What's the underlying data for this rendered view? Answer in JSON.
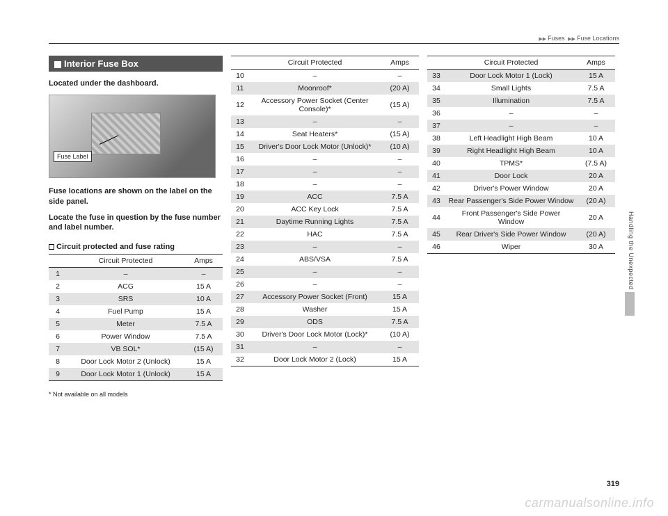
{
  "breadcrumb": {
    "part1": "Fuses",
    "part2": "Fuse Locations"
  },
  "section_title": "Interior Fuse Box",
  "intro_line": "Located under the dashboard.",
  "figure_label": "Fuse Label",
  "para1": "Fuse locations are shown on the label on the side panel.",
  "para2": "Locate the fuse in question by the fuse number and label number.",
  "subhead": "Circuit protected and fuse rating",
  "headers": {
    "circuit": "Circuit Protected",
    "amps": "Amps"
  },
  "table1": [
    {
      "n": "1",
      "c": "–",
      "a": "–"
    },
    {
      "n": "2",
      "c": "ACG",
      "a": "15 A"
    },
    {
      "n": "3",
      "c": "SRS",
      "a": "10 A"
    },
    {
      "n": "4",
      "c": "Fuel Pump",
      "a": "15 A"
    },
    {
      "n": "5",
      "c": "Meter",
      "a": "7.5 A"
    },
    {
      "n": "6",
      "c": "Power Window",
      "a": "7.5 A"
    },
    {
      "n": "7",
      "c": "VB SOL*",
      "a": "(15 A)"
    },
    {
      "n": "8",
      "c": "Door Lock Motor 2 (Unlock)",
      "a": "15 A"
    },
    {
      "n": "9",
      "c": "Door Lock Motor 1 (Unlock)",
      "a": "15 A"
    }
  ],
  "table2": [
    {
      "n": "10",
      "c": "–",
      "a": "–"
    },
    {
      "n": "11",
      "c": "Moonroof*",
      "a": "(20 A)"
    },
    {
      "n": "12",
      "c": "Accessory Power Socket (Center Console)*",
      "a": "(15 A)"
    },
    {
      "n": "13",
      "c": "–",
      "a": "–"
    },
    {
      "n": "14",
      "c": "Seat Heaters*",
      "a": "(15 A)"
    },
    {
      "n": "15",
      "c": "Driver's Door Lock Motor (Unlock)*",
      "a": "(10 A)"
    },
    {
      "n": "16",
      "c": "–",
      "a": "–"
    },
    {
      "n": "17",
      "c": "–",
      "a": "–"
    },
    {
      "n": "18",
      "c": "–",
      "a": "–"
    },
    {
      "n": "19",
      "c": "ACC",
      "a": "7.5 A"
    },
    {
      "n": "20",
      "c": "ACC Key Lock",
      "a": "7.5 A"
    },
    {
      "n": "21",
      "c": "Daytime Running Lights",
      "a": "7.5 A"
    },
    {
      "n": "22",
      "c": "HAC",
      "a": "7.5 A"
    },
    {
      "n": "23",
      "c": "–",
      "a": "–"
    },
    {
      "n": "24",
      "c": "ABS/VSA",
      "a": "7.5 A"
    },
    {
      "n": "25",
      "c": "–",
      "a": "–"
    },
    {
      "n": "26",
      "c": "–",
      "a": "–"
    },
    {
      "n": "27",
      "c": "Accessory Power Socket (Front)",
      "a": "15 A"
    },
    {
      "n": "28",
      "c": "Washer",
      "a": "15 A"
    },
    {
      "n": "29",
      "c": "ODS",
      "a": "7.5 A"
    },
    {
      "n": "30",
      "c": "Driver's Door Lock Motor (Lock)*",
      "a": "(10 A)"
    },
    {
      "n": "31",
      "c": "–",
      "a": "–"
    },
    {
      "n": "32",
      "c": "Door Lock Motor 2 (Lock)",
      "a": "15 A"
    }
  ],
  "table3": [
    {
      "n": "33",
      "c": "Door Lock Motor 1 (Lock)",
      "a": "15 A"
    },
    {
      "n": "34",
      "c": "Small Lights",
      "a": "7.5 A"
    },
    {
      "n": "35",
      "c": "Illumination",
      "a": "7.5 A"
    },
    {
      "n": "36",
      "c": "–",
      "a": "–"
    },
    {
      "n": "37",
      "c": "–",
      "a": "–"
    },
    {
      "n": "38",
      "c": "Left Headlight High Beam",
      "a": "10 A"
    },
    {
      "n": "39",
      "c": "Right Headlight High Beam",
      "a": "10 A"
    },
    {
      "n": "40",
      "c": "TPMS*",
      "a": "(7.5 A)"
    },
    {
      "n": "41",
      "c": "Door Lock",
      "a": "20 A"
    },
    {
      "n": "42",
      "c": "Driver's Power Window",
      "a": "20 A"
    },
    {
      "n": "43",
      "c": "Rear Passenger's Side Power Window",
      "a": "(20 A)"
    },
    {
      "n": "44",
      "c": "Front Passenger's Side Power Window",
      "a": "20 A"
    },
    {
      "n": "45",
      "c": "Rear Driver's Side Power Window",
      "a": "(20 A)"
    },
    {
      "n": "46",
      "c": "Wiper",
      "a": "30 A"
    }
  ],
  "footnote": "* Not available on all models",
  "side_tab": "Handling the Unexpected",
  "page_number": "319",
  "watermark": "carmanualsonline.info"
}
